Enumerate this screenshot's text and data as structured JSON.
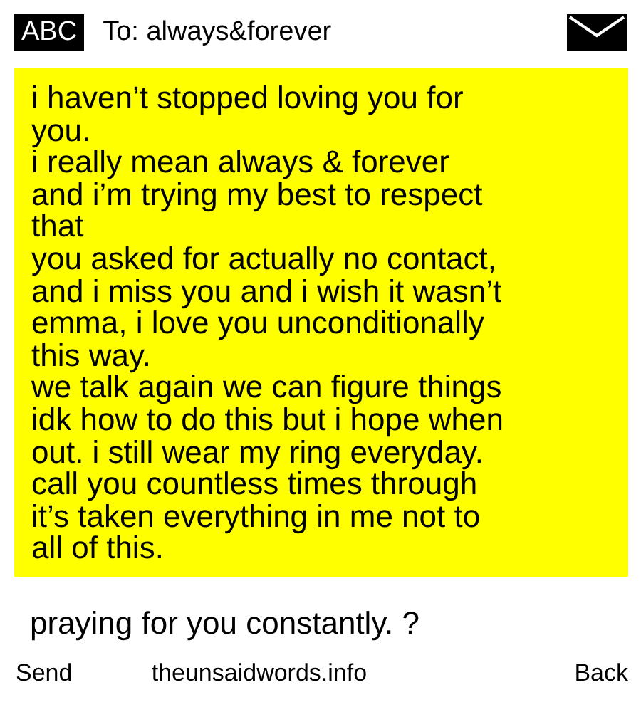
{
  "header": {
    "mode": "ABC",
    "recipient": "To: always&forever"
  },
  "message_lines": [
    "i haven’t stopped loving you for",
    "you.",
    "i really mean always & forever",
    "and i’m trying my best to respect",
    "that",
    "you asked for actually no contact,",
    "and i miss you and i wish it wasn’t",
    "emma, i love you unconditionally",
    "this way.",
    "we talk again we can figure things",
    "idk how to do this but i hope when",
    "out. i still wear my ring everyday.",
    "call you countless times through",
    "it’s taken everything in me not to",
    "all of this."
  ],
  "message_tail": "praying for you constantly. ?",
  "softkeys": [
    {
      "label": "Send"
    },
    {
      "label": "theunsaidwords.info"
    },
    {
      "label": "Back"
    }
  ]
}
